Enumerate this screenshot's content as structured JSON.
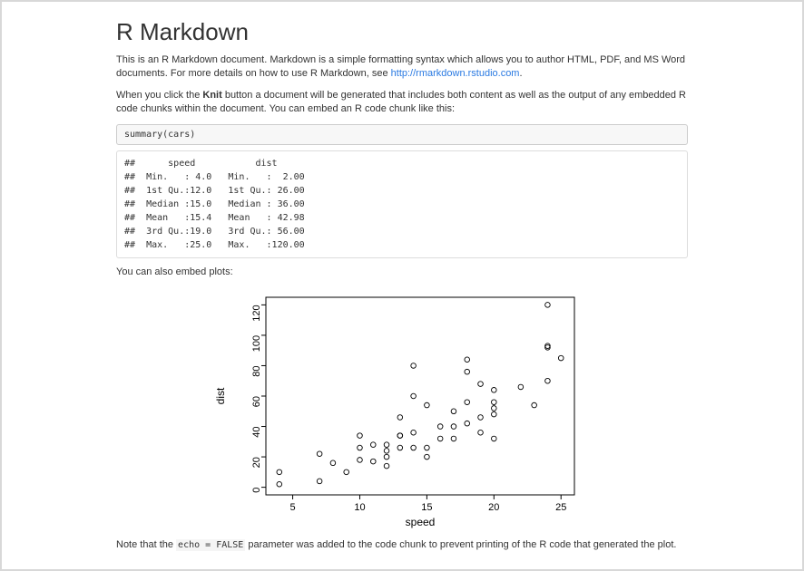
{
  "heading": "R Markdown",
  "para1_before": "This is an R Markdown document. Markdown is a simple formatting syntax which allows you to author HTML, PDF, and MS Word documents. For more details on how to use R Markdown, see ",
  "para1_link_text": "http://rmarkdown.rstudio.com",
  "para1_link_href": "http://rmarkdown.rstudio.com",
  "para1_after": ".",
  "para2_before": "When you click the ",
  "para2_strong": "Knit",
  "para2_after": " button a document will be generated that includes both content as well as the output of any embedded R code chunks within the document. You can embed an R code chunk like this:",
  "code1": "summary(cars)",
  "output1": "##      speed           dist\n##  Min.   : 4.0   Min.   :  2.00\n##  1st Qu.:12.0   1st Qu.: 26.00\n##  Median :15.0   Median : 36.00\n##  Mean   :15.4   Mean   : 42.98\n##  3rd Qu.:19.0   3rd Qu.: 56.00\n##  Max.   :25.0   Max.   :120.00",
  "para3": "You can also embed plots:",
  "note_before": "Note that the ",
  "note_code": "echo = FALSE",
  "note_after": " parameter was added to the code chunk to prevent printing of the R code that generated the plot.",
  "chart_data": {
    "type": "scatter",
    "xlabel": "speed",
    "ylabel": "dist",
    "xlim": [
      3,
      26
    ],
    "ylim": [
      -5,
      125
    ],
    "xticks": [
      5,
      10,
      15,
      20,
      25
    ],
    "yticks": [
      0,
      20,
      40,
      60,
      80,
      100,
      120
    ],
    "points": [
      [
        4,
        2
      ],
      [
        4,
        10
      ],
      [
        7,
        4
      ],
      [
        7,
        22
      ],
      [
        8,
        16
      ],
      [
        9,
        10
      ],
      [
        10,
        18
      ],
      [
        10,
        26
      ],
      [
        10,
        34
      ],
      [
        11,
        17
      ],
      [
        11,
        28
      ],
      [
        12,
        14
      ],
      [
        12,
        20
      ],
      [
        12,
        24
      ],
      [
        12,
        28
      ],
      [
        13,
        26
      ],
      [
        13,
        34
      ],
      [
        13,
        34
      ],
      [
        13,
        46
      ],
      [
        14,
        26
      ],
      [
        14,
        36
      ],
      [
        14,
        60
      ],
      [
        14,
        80
      ],
      [
        15,
        20
      ],
      [
        15,
        26
      ],
      [
        15,
        54
      ],
      [
        16,
        32
      ],
      [
        16,
        40
      ],
      [
        17,
        32
      ],
      [
        17,
        40
      ],
      [
        17,
        50
      ],
      [
        18,
        42
      ],
      [
        18,
        56
      ],
      [
        18,
        76
      ],
      [
        18,
        84
      ],
      [
        19,
        36
      ],
      [
        19,
        46
      ],
      [
        19,
        68
      ],
      [
        20,
        32
      ],
      [
        20,
        48
      ],
      [
        20,
        52
      ],
      [
        20,
        56
      ],
      [
        20,
        64
      ],
      [
        22,
        66
      ],
      [
        23,
        54
      ],
      [
        24,
        70
      ],
      [
        24,
        92
      ],
      [
        24,
        93
      ],
      [
        24,
        120
      ],
      [
        25,
        85
      ]
    ]
  }
}
